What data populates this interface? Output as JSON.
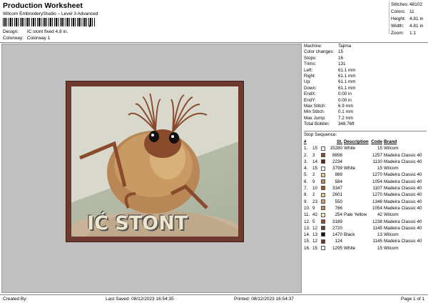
{
  "header": {
    "title": "Production Worksheet",
    "subtitle": "Wilcom EmbroideryStudio – Level 3 Advanced",
    "barcode_suffix": "/",
    "design_label": "Design:",
    "design_value": "IC stont fixed 4,8 in.",
    "colorway_label": "Colorway:",
    "colorway_value": "Colorway 1"
  },
  "stats": [
    {
      "k": "Stitches:",
      "v": "48102"
    },
    {
      "k": "Colors:",
      "v": "11"
    },
    {
      "k": "Height:",
      "v": "4.81 in"
    },
    {
      "k": "Width:",
      "v": "4.81 in"
    },
    {
      "k": "Zoom:",
      "v": "1:1"
    }
  ],
  "design_text": "IĆ STONT",
  "machine_info": [
    {
      "k": "Machine:",
      "v": "Tajima"
    },
    {
      "k": "Color changes:",
      "v": "15"
    },
    {
      "k": "Stops:",
      "v": "16"
    },
    {
      "k": "Trims:",
      "v": "131"
    },
    {
      "k": "Left:",
      "v": "61.1 mm"
    },
    {
      "k": "Right:",
      "v": "61.1 mm"
    },
    {
      "k": "Up:",
      "v": "61.1 mm"
    },
    {
      "k": "Down:",
      "v": "61.1 mm"
    },
    {
      "k": "EndX:",
      "v": "0.00 in"
    },
    {
      "k": "EndY:",
      "v": "0.00 in"
    },
    {
      "k": "Max Stitch:",
      "v": "6.9 mm"
    },
    {
      "k": "Min Stitch:",
      "v": "0.1 mm"
    },
    {
      "k": "Max Jump:",
      "v": "7.2 mm"
    },
    {
      "k": "Total Bobbin:",
      "v": "348.76ft"
    }
  ],
  "sequence": {
    "heading": "Stop Sequence:",
    "columns": [
      "#",
      "",
      "",
      "St.",
      "Description",
      "Code",
      "Brand"
    ],
    "rows": [
      {
        "stop": "1.",
        "n": "15",
        "color": "#ffffff",
        "st": "15280",
        "desc": "White",
        "code": "15",
        "brand": "Wilcom"
      },
      {
        "stop": "2.",
        "n": "3",
        "color": "#8a4a2c",
        "st": "8898",
        "desc": "",
        "code": "1257",
        "brand": "Madeira Classic 40"
      },
      {
        "stop": "3.",
        "n": "14",
        "color": "#5c2a1a",
        "st": "2234",
        "desc": "",
        "code": "1130",
        "brand": "Madeira Classic 40"
      },
      {
        "stop": "4.",
        "n": "15",
        "color": "#ffffff",
        "st": "3799",
        "desc": "White",
        "code": "15",
        "brand": "Wilcom"
      },
      {
        "stop": "5.",
        "n": "2",
        "color": "#e8c78a",
        "st": "989",
        "desc": "",
        "code": "1270",
        "brand": "Madeira Classic 40"
      },
      {
        "stop": "6.",
        "n": "9",
        "color": "#b98b5c",
        "st": "584",
        "desc": "",
        "code": "1054",
        "brand": "Madeira Classic 40"
      },
      {
        "stop": "7.",
        "n": "10",
        "color": "#a0542c",
        "st": "3347",
        "desc": "",
        "code": "1107",
        "brand": "Madeira Classic 40"
      },
      {
        "stop": "8.",
        "n": "2",
        "color": "#e8c78a",
        "st": "2601",
        "desc": "",
        "code": "1270",
        "brand": "Madeira Classic 40"
      },
      {
        "stop": "9.",
        "n": "23",
        "color": "#c9a36a",
        "st": "550",
        "desc": "",
        "code": "1348",
        "brand": "Madeira Classic 40"
      },
      {
        "stop": "10.",
        "n": "9",
        "color": "#b98b5c",
        "st": "766",
        "desc": "",
        "code": "1054",
        "brand": "Madeira Classic 40"
      },
      {
        "stop": "11.",
        "n": "42",
        "color": "#f4e9b8",
        "st": "254",
        "desc": "Pale Yellow",
        "code": "42",
        "brand": "Wilcom"
      },
      {
        "stop": "12.",
        "n": "5",
        "color": "#9c4a30",
        "st": "3189",
        "desc": "",
        "code": "1238",
        "brand": "Madeira Classic 40"
      },
      {
        "stop": "13.",
        "n": "12",
        "color": "#6b3a2a",
        "st": "2720",
        "desc": "",
        "code": "1145",
        "brand": "Madeira Classic 40"
      },
      {
        "stop": "14.",
        "n": "13",
        "color": "#111111",
        "st": "1470",
        "desc": "Black",
        "code": "13",
        "brand": "Wilcom"
      },
      {
        "stop": "15.",
        "n": "12",
        "color": "#6b3a2a",
        "st": "124",
        "desc": "",
        "code": "1145",
        "brand": "Madeira Classic 40"
      },
      {
        "stop": "16.",
        "n": "15",
        "color": "#ffffff",
        "st": "1295",
        "desc": "White",
        "code": "15",
        "brand": "Wilcom"
      }
    ]
  },
  "footer": {
    "created_by": "Created By:",
    "last_saved": "Last Saved: 08/12/2023 16:54:35",
    "printed": "Printed: 08/12/2023 16:54:37",
    "page": "Page 1 of 1"
  }
}
